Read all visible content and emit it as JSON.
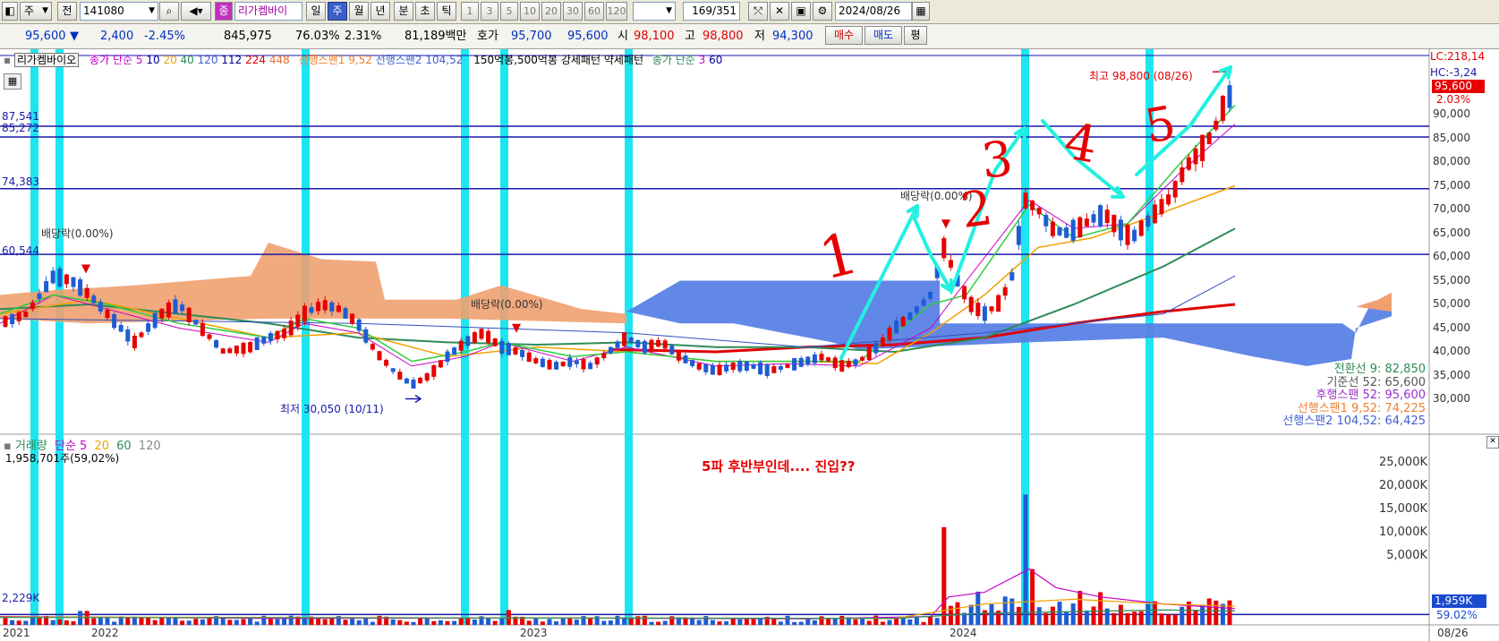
{
  "toolbar": {
    "period_select": "주",
    "prev_label": "전",
    "code": "141080",
    "stock_name": "리가켐바이",
    "stock_prefix": "종",
    "periods": [
      "일",
      "주",
      "월",
      "년",
      "분",
      "초",
      "틱"
    ],
    "active_period": "주",
    "intervals": [
      "1",
      "3",
      "5",
      "10",
      "20",
      "30",
      "60",
      "120"
    ],
    "page_count": "169/351",
    "date": "2024/08/26"
  },
  "quote": {
    "price": "95,600",
    "change_arrow": "▼",
    "change": "2,400",
    "change_pct": "-2.45%",
    "volume": "845,975",
    "ratio1": "76.03%",
    "ratio2": "2.31%",
    "amount": "81,189백만",
    "hoga_label": "호가",
    "ask": "95,700",
    "bid": "95,600",
    "open_label": "시",
    "open": "98,100",
    "high_label": "고",
    "high": "98,800",
    "low_label": "저",
    "low": "94,300",
    "buy_button": "매수",
    "sell_button": "매도",
    "eval_button": "평"
  },
  "legend": {
    "name": "리가켐바이오",
    "price_ma_label": "종가 단순",
    "ma_periods": [
      "5",
      "10",
      "20",
      "40",
      "120",
      "112",
      "224",
      "448"
    ],
    "span_labels": [
      "선행스팬1 9,52",
      "선행스팬2 104,52"
    ],
    "pattern_labels": [
      "150억봉,500억봉",
      "강세패턴",
      "약세패턴"
    ],
    "price_ma2_label": "종가 단순",
    "ma2_periods": [
      "3",
      "60"
    ]
  },
  "price_levels": [
    "87,541",
    "85,272",
    "74,383",
    "60,544"
  ],
  "annotations": {
    "dividend": [
      "배당락(0.00%)",
      "배당락(0.00%)",
      "배당락(0.00%)"
    ],
    "high": "최고 98,800 (08/26)",
    "low": "최저 30,050 (10/11)",
    "wave_numbers": [
      "1",
      "2",
      "3",
      "4",
      "5"
    ],
    "question": "5파 후반부인데.... 진입??"
  },
  "right_axis": {
    "top": [
      "LC:218,14",
      "HC:-3,24"
    ],
    "price_tag": "95,600",
    "pct_tag": "2.03%",
    "ticks": [
      "90,000",
      "85,000",
      "80,000",
      "75,000",
      "70,000",
      "65,000",
      "60,000",
      "55,000",
      "50,000",
      "45,000",
      "40,000",
      "35,000",
      "30,000"
    ]
  },
  "ichimoku": [
    {
      "label": "전환선 9: 82,850",
      "color": "#2e8b57"
    },
    {
      "label": "기준선 52: 65,600",
      "color": "#555555"
    },
    {
      "label": "후행스팬 52: 95,600",
      "color": "#9b30c8"
    },
    {
      "label": "선행스팬1 9,52: 74,225",
      "color": "#f08030"
    },
    {
      "label": "선행스팬2 104,52: 64,425",
      "color": "#4060d0"
    }
  ],
  "volume_panel": {
    "title": "거래량",
    "ma_label": "단순",
    "ma_periods": [
      "5",
      "20",
      "60",
      "120"
    ],
    "current": "1,958,701주(59,02%)",
    "left_level": "2,229K",
    "ticks": [
      "25,000K",
      "20,000K",
      "15,000K",
      "10,000K",
      "5,000K"
    ],
    "tag": "1,959K",
    "tag_pct": "59.02%"
  },
  "x_axis": [
    "2021",
    "2022",
    "2023",
    "2024",
    "08/26"
  ],
  "colors": {
    "up": "#e60000",
    "down": "#1e5cd4",
    "highlight": "#1ee6f0",
    "cloud_bear": "#f0a070",
    "cloud_bull": "#5a82e6",
    "level": "#1a1aa8"
  }
}
